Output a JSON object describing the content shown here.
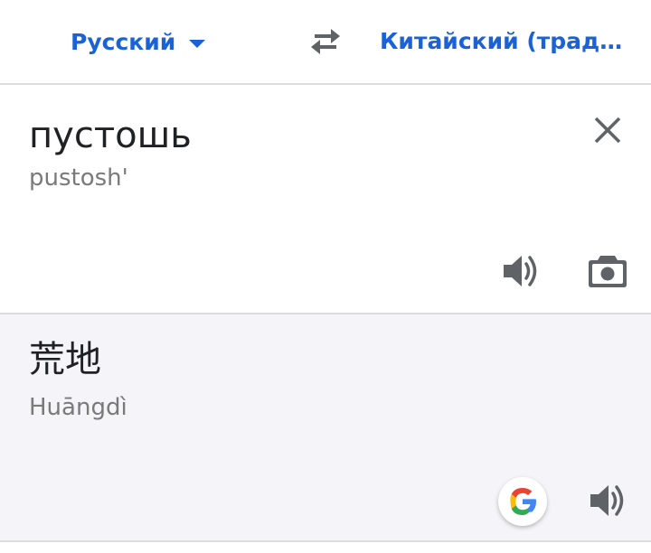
{
  "languages": {
    "source": "Русский",
    "target": "Китайский (традиц…"
  },
  "source": {
    "text": "пустошь",
    "transliteration": "pustosh'"
  },
  "result": {
    "text": "荒地",
    "transliteration": "Huāngdì"
  },
  "icons": {
    "dropdown": "caret-down-icon",
    "swap": "swap-arrows-icon",
    "clear": "close-icon",
    "source_speaker": "speaker-icon",
    "camera": "camera-icon",
    "google": "google-logo-icon",
    "result_speaker": "speaker-icon"
  },
  "colors": {
    "accent": "#1a62d6",
    "icon_gray": "#5f6368",
    "result_background": "#f4f4f9",
    "secondary_text": "#7a7a7a"
  }
}
